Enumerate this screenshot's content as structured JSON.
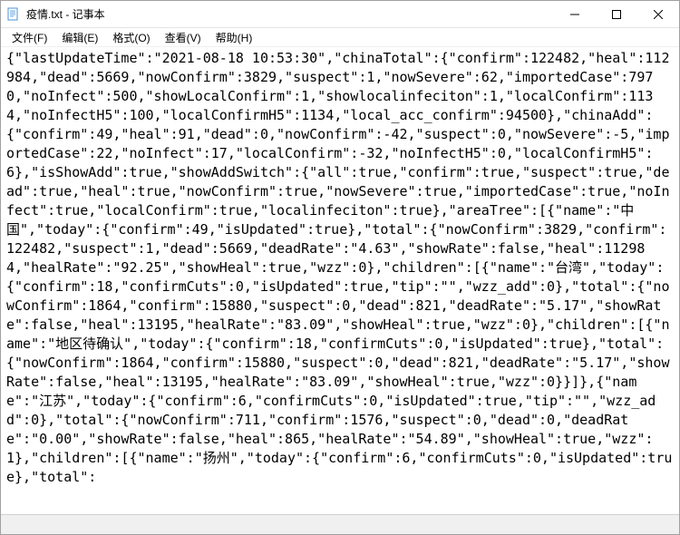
{
  "window": {
    "title": "疫情.txt - 记事本"
  },
  "menu": {
    "file": "文件(F)",
    "edit": "编辑(E)",
    "format": "格式(O)",
    "view": "查看(V)",
    "help": "帮助(H)"
  },
  "content": "{\"lastUpdateTime\":\"2021-08-18 10:53:30\",\"chinaTotal\":{\"confirm\":122482,\"heal\":112984,\"dead\":5669,\"nowConfirm\":3829,\"suspect\":1,\"nowSevere\":62,\"importedCase\":7970,\"noInfect\":500,\"showLocalConfirm\":1,\"showlocalinfeciton\":1,\"localConfirm\":1134,\"noInfectH5\":100,\"localConfirmH5\":1134,\"local_acc_confirm\":94500},\"chinaAdd\":{\"confirm\":49,\"heal\":91,\"dead\":0,\"nowConfirm\":-42,\"suspect\":0,\"nowSevere\":-5,\"importedCase\":22,\"noInfect\":17,\"localConfirm\":-32,\"noInfectH5\":0,\"localConfirmH5\":6},\"isShowAdd\":true,\"showAddSwitch\":{\"all\":true,\"confirm\":true,\"suspect\":true,\"dead\":true,\"heal\":true,\"nowConfirm\":true,\"nowSevere\":true,\"importedCase\":true,\"noInfect\":true,\"localConfirm\":true,\"localinfeciton\":true},\"areaTree\":[{\"name\":\"中国\",\"today\":{\"confirm\":49,\"isUpdated\":true},\"total\":{\"nowConfirm\":3829,\"confirm\":122482,\"suspect\":1,\"dead\":5669,\"deadRate\":\"4.63\",\"showRate\":false,\"heal\":112984,\"healRate\":\"92.25\",\"showHeal\":true,\"wzz\":0},\"children\":[{\"name\":\"台湾\",\"today\":{\"confirm\":18,\"confirmCuts\":0,\"isUpdated\":true,\"tip\":\"\",\"wzz_add\":0},\"total\":{\"nowConfirm\":1864,\"confirm\":15880,\"suspect\":0,\"dead\":821,\"deadRate\":\"5.17\",\"showRate\":false,\"heal\":13195,\"healRate\":\"83.09\",\"showHeal\":true,\"wzz\":0},\"children\":[{\"name\":\"地区待确认\",\"today\":{\"confirm\":18,\"confirmCuts\":0,\"isUpdated\":true},\"total\":{\"nowConfirm\":1864,\"confirm\":15880,\"suspect\":0,\"dead\":821,\"deadRate\":\"5.17\",\"showRate\":false,\"heal\":13195,\"healRate\":\"83.09\",\"showHeal\":true,\"wzz\":0}}]},{\"name\":\"江苏\",\"today\":{\"confirm\":6,\"confirmCuts\":0,\"isUpdated\":true,\"tip\":\"\",\"wzz_add\":0},\"total\":{\"nowConfirm\":711,\"confirm\":1576,\"suspect\":0,\"dead\":0,\"deadRate\":\"0.00\",\"showRate\":false,\"heal\":865,\"healRate\":\"54.89\",\"showHeal\":true,\"wzz\":1},\"children\":[{\"name\":\"扬州\",\"today\":{\"confirm\":6,\"confirmCuts\":0,\"isUpdated\":true},\"total\":"
}
